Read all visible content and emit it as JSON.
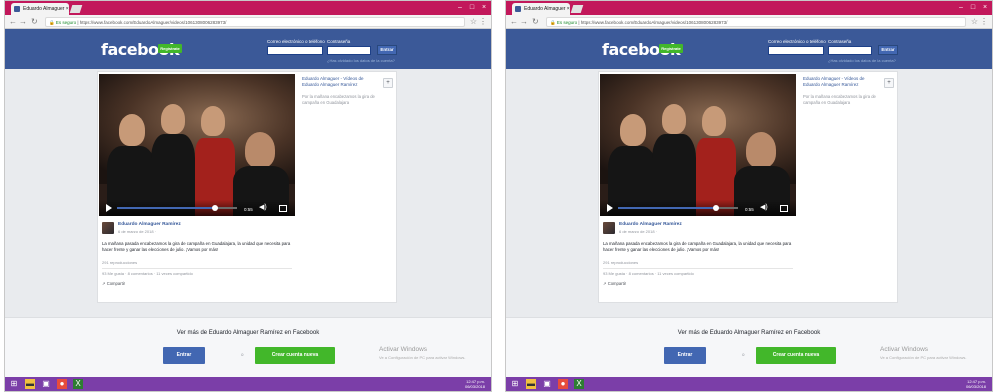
{
  "screenshots": [
    {
      "id": "left",
      "browser": {
        "tab_title": "Eduardo Almaguer ×",
        "url_secure_label": "Es seguro",
        "url": "https://www.facebook.com/EduardoAlmaguer/videos/1061308006283973/"
      },
      "facebook": {
        "logo": "facebook",
        "signup_label": "Regístrate",
        "email_label": "Correo electrónico o teléfono",
        "password_label": "Contraseña",
        "login_label": "Entrar",
        "forgot_label": "¿Has olvidado los datos de la cuenta?"
      },
      "sidebar": {
        "title": "Eduardo Almaguer - Vídeos de Eduardo Almaguer Ramírez",
        "meta": "Por la mañana encabezamos la gira de campaña en Guadalajara",
        "button": "+"
      },
      "video": {
        "time": "0:55",
        "progress": 0.82
      },
      "post": {
        "author": "Eduardo Almaguer Ramírez",
        "date": "6 de marzo de 2018 · ",
        "text": "La mañana pasada encabezamos la gira de campaña en Guadalajara, la unidad que necesita para hacer frente y ganar las elecciones de julio. ¡Vamos por más!",
        "views": "291 reproducciones",
        "interactions": "93 Me gusta · 8 comentarios · 11 veces compartido",
        "share": "Compartir"
      },
      "promo": {
        "see_more": "Ver más de Eduardo Almaguer Ramírez en Facebook",
        "login": "Entrar",
        "or": "o",
        "create": "Crear cuenta nueva"
      },
      "watermark": {
        "title": "Activar Windows",
        "subtitle": "Ve a Configuración de PC para activar Windows."
      },
      "taskbar": {
        "time": "12:47 p.m.",
        "date": "06/03/2018"
      }
    },
    {
      "id": "right",
      "browser": {
        "tab_title": "Eduardo Almaguer ×",
        "url_secure_label": "Es seguro",
        "url": "https://www.facebook.com/EduardoAlmaguer/videos/1061308006283973/"
      },
      "facebook": {
        "logo": "facebook",
        "signup_label": "Regístrate",
        "email_label": "Correo electrónico o teléfono",
        "password_label": "Contraseña",
        "login_label": "Entrar",
        "forgot_label": "¿Has olvidado los datos de la cuenta?"
      },
      "sidebar": {
        "title": "Eduardo Almaguer - Vídeos de Eduardo Almaguer Ramírez",
        "meta": "Por la mañana encabezamos la gira de campaña en Guadalajara",
        "button": "+"
      },
      "video": {
        "time": "0:55",
        "progress": 0.82
      },
      "post": {
        "author": "Eduardo Almaguer Ramírez",
        "date": "6 de marzo de 2018 · ",
        "text": "La mañana pasada encabezamos la gira de campaña en Guadalajara, la unidad que necesita para hacer frente y ganar las elecciones de julio. ¡Vamos por más!",
        "views": "291 reproducciones",
        "interactions": "93 Me gusta · 8 comentarios · 11 veces compartido",
        "share": "Compartir"
      },
      "promo": {
        "see_more": "Ver más de Eduardo Almaguer Ramírez en Facebook",
        "login": "Entrar",
        "or": "o",
        "create": "Crear cuenta nueva"
      },
      "watermark": {
        "title": "Activar Windows",
        "subtitle": "Ve a Configuración de PC para activar Windows."
      },
      "taskbar": {
        "time": "12:47 p.m.",
        "date": "06/03/2018"
      }
    }
  ],
  "colors": {
    "facebook_blue": "#3b5998",
    "signup_green": "#42b72a",
    "titlebar": "#c2185b",
    "taskbar": "#7b3ea8"
  },
  "icons": [
    "facebook-favicon",
    "back-arrow-icon",
    "forward-arrow-icon",
    "reload-icon",
    "lock-icon",
    "star-icon",
    "menu-icon",
    "play-icon",
    "volume-icon",
    "fullscreen-icon",
    "windows-start-icon",
    "file-explorer-icon",
    "store-icon",
    "chrome-icon"
  ]
}
